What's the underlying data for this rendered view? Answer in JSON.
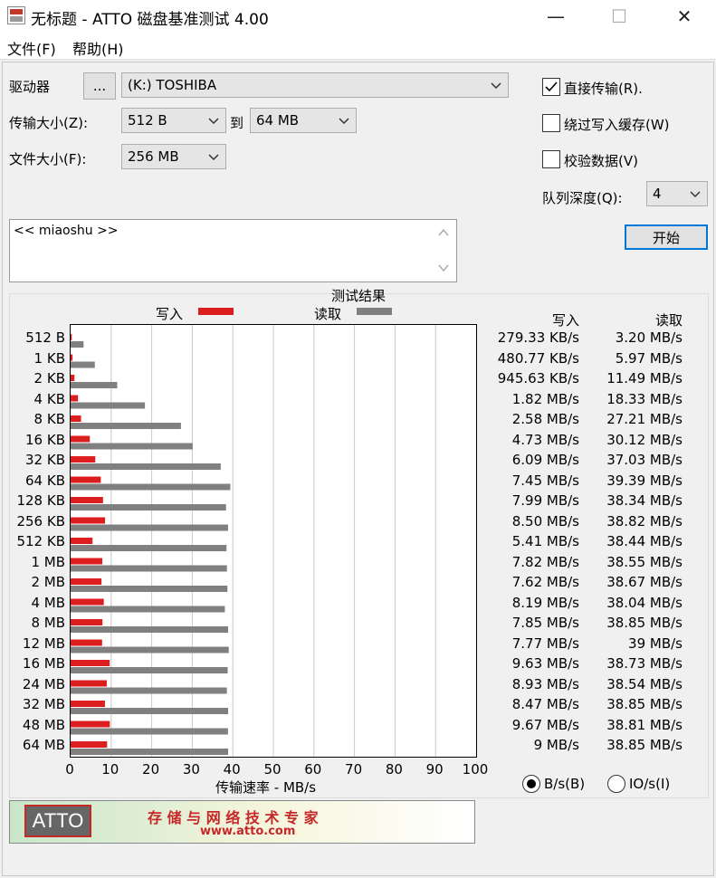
{
  "window": {
    "title": "无标题 - ATTO 磁盘基准测试 4.00",
    "minimize_glyph": "—",
    "maximize_glyph": "☐",
    "close_glyph": "✕"
  },
  "menu": {
    "file": "文件(F)",
    "help": "帮助(H)"
  },
  "form": {
    "drive_label": "驱动器",
    "browse_label": "...",
    "drive_value": "(K:) TOSHIBA",
    "transfer_size_label": "传输大小(Z):",
    "transfer_from": "512 B",
    "to_label": "到",
    "transfer_to": "64 MB",
    "file_size_label": "文件大小(F):",
    "file_size_value": "256 MB",
    "direct_io_label": "直接传输(R).",
    "direct_io_checked": true,
    "bypass_cache_label": "绕过写入缓存(W)",
    "bypass_cache_checked": false,
    "verify_label": "校验数据(V)",
    "verify_checked": false,
    "queue_depth_label": "队列深度(Q):",
    "queue_depth_value": "4",
    "start_label": "开始",
    "description": "<< miaoshu >>"
  },
  "chart_header": {
    "title": "测试结果",
    "write_legend": "写入",
    "read_legend": "读取",
    "write_col": "写入",
    "read_col": "读取"
  },
  "chart_data": {
    "type": "bar",
    "title": "测试结果",
    "xlabel": "传输速率 - MB/s",
    "ylabel": "",
    "xlim": [
      0,
      100
    ],
    "x_ticks": [
      "0",
      "10",
      "20",
      "30",
      "40",
      "50",
      "60",
      "70",
      "80",
      "90",
      "100"
    ],
    "grid": true,
    "orientation": "horizontal",
    "colors": {
      "write": "#dd1e1e",
      "read": "#808080"
    },
    "categories": [
      "512 B",
      "1 KB",
      "2 KB",
      "4 KB",
      "8 KB",
      "16 KB",
      "32 KB",
      "64 KB",
      "128 KB",
      "256 KB",
      "512 KB",
      "1 MB",
      "2 MB",
      "4 MB",
      "8 MB",
      "12 MB",
      "16 MB",
      "24 MB",
      "32 MB",
      "48 MB",
      "64 MB"
    ],
    "series": [
      {
        "name": "写入",
        "values": [
          0.27933,
          0.48077,
          0.94563,
          1.82,
          2.58,
          4.73,
          6.09,
          7.45,
          7.99,
          8.5,
          5.41,
          7.82,
          7.62,
          8.19,
          7.85,
          7.77,
          9.63,
          8.93,
          8.47,
          9.67,
          9
        ]
      },
      {
        "name": "读取",
        "values": [
          3.2,
          5.97,
          11.49,
          18.33,
          27.21,
          30.12,
          37.03,
          39.39,
          38.34,
          38.82,
          38.44,
          38.55,
          38.67,
          38.04,
          38.85,
          39,
          38.73,
          38.54,
          38.85,
          38.81,
          38.85
        ]
      }
    ],
    "write_text": [
      "279.33 KB/s",
      "480.77 KB/s",
      "945.63 KB/s",
      "1.82 MB/s",
      "2.58 MB/s",
      "4.73 MB/s",
      "6.09 MB/s",
      "7.45 MB/s",
      "7.99 MB/s",
      "8.50 MB/s",
      "5.41 MB/s",
      "7.82 MB/s",
      "7.62 MB/s",
      "8.19 MB/s",
      "7.85 MB/s",
      "7.77 MB/s",
      "9.63 MB/s",
      "8.93 MB/s",
      "8.47 MB/s",
      "9.67 MB/s",
      "9 MB/s"
    ],
    "read_text": [
      "3.20 MB/s",
      "5.97 MB/s",
      "11.49 MB/s",
      "18.33 MB/s",
      "27.21 MB/s",
      "30.12 MB/s",
      "37.03 MB/s",
      "39.39 MB/s",
      "38.34 MB/s",
      "38.82 MB/s",
      "38.44 MB/s",
      "38.55 MB/s",
      "38.67 MB/s",
      "38.04 MB/s",
      "38.85 MB/s",
      "39 MB/s",
      "38.73 MB/s",
      "38.54 MB/s",
      "38.85 MB/s",
      "38.81 MB/s",
      "38.85 MB/s"
    ]
  },
  "units": {
    "bs_label": "B/s(B)",
    "bs_selected": true,
    "ios_label": "IO/s(I)",
    "ios_selected": false
  },
  "banner": {
    "logo": "ATTO",
    "slogan": "存 储 与 网 络 技 术 专 家",
    "url": "www.atto.com"
  }
}
